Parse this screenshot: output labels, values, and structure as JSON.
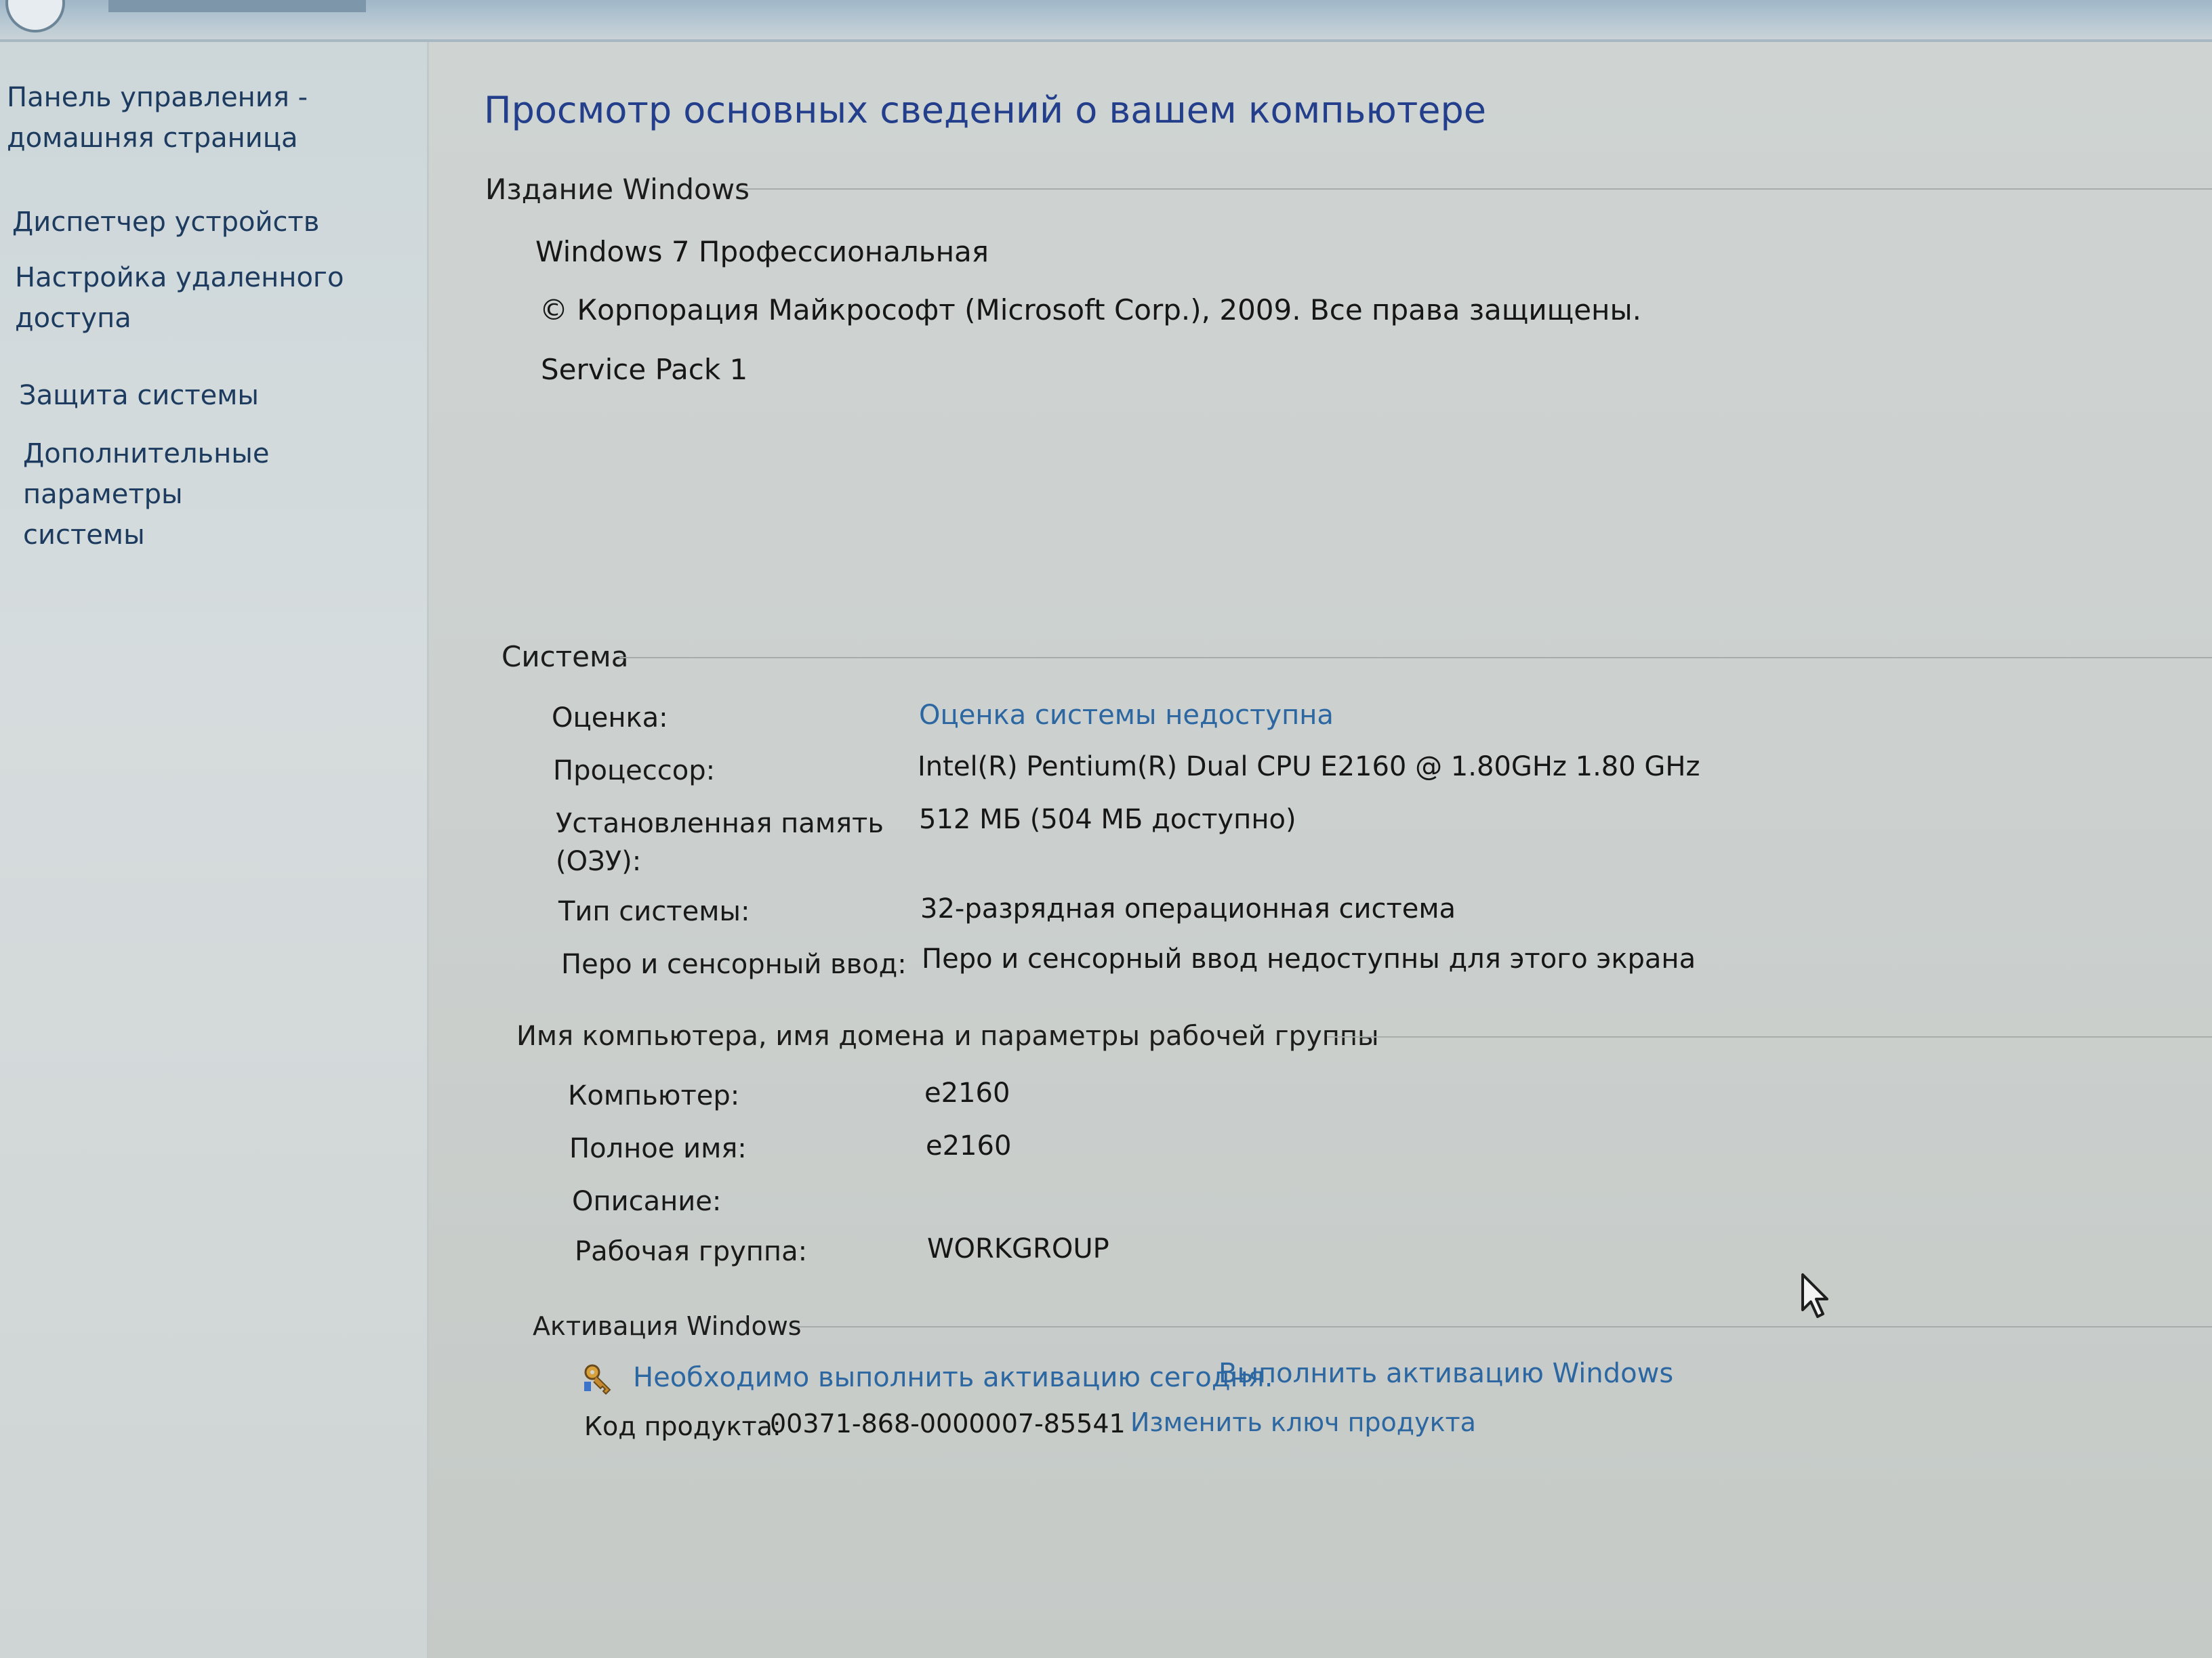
{
  "sidebar": {
    "items": [
      {
        "label": "Панель управления -\nдомашняя страница"
      },
      {
        "label": "Диспетчер устройств"
      },
      {
        "label": "Настройка удаленного\nдоступа"
      },
      {
        "label": "Защита системы"
      },
      {
        "label": "Дополнительные параметры\nсистемы"
      }
    ]
  },
  "main": {
    "title": "Просмотр основных сведений о вашем компьютере",
    "windows_edition": {
      "heading": "Издание Windows",
      "edition": "Windows 7 Профессиональная",
      "copyright": "© Корпорация Майкрософт (Microsoft Corp.), 2009. Все права защищены.",
      "service_pack": "Service Pack 1"
    },
    "system": {
      "heading": "Система",
      "rating_label": "Оценка:",
      "rating_value": "Оценка системы недоступна",
      "processor_label": "Процессор:",
      "processor_value": "Intel(R) Pentium(R) Dual  CPU  E2160  @ 1.80GHz   1.80 GHz",
      "memory_label": "Установленная память\n(ОЗУ):",
      "memory_value": "512 МБ (504 МБ доступно)",
      "system_type_label": "Тип системы:",
      "system_type_value": "32-разрядная операционная система",
      "pen_label": "Перо и сенсорный ввод:",
      "pen_value": "Перо и сенсорный ввод недоступны для этого экрана"
    },
    "computer_name": {
      "heading": "Имя компьютера, имя домена и параметры рабочей группы",
      "computer_label": "Компьютер:",
      "computer_value": "e2160",
      "full_name_label": "Полное имя:",
      "full_name_value": "e2160",
      "description_label": "Описание:",
      "workgroup_label": "Рабочая группа:",
      "workgroup_value": "WORKGROUP"
    },
    "activation": {
      "heading": "Активация Windows",
      "status_link": "Необходимо выполнить активацию сегодня.",
      "activate_link": "Выполнить активацию Windows",
      "product_key_label": "Код продукта:",
      "product_key_value": "00371-868-0000007-85541",
      "change_key_link": "Изменить ключ продукта"
    }
  },
  "colors": {
    "link": "#2c67a2",
    "title": "#233f8c",
    "sidebar_link": "#1d3b5f"
  },
  "icons": {
    "activation": "key-icon",
    "cursor": "mouse-pointer-icon"
  }
}
